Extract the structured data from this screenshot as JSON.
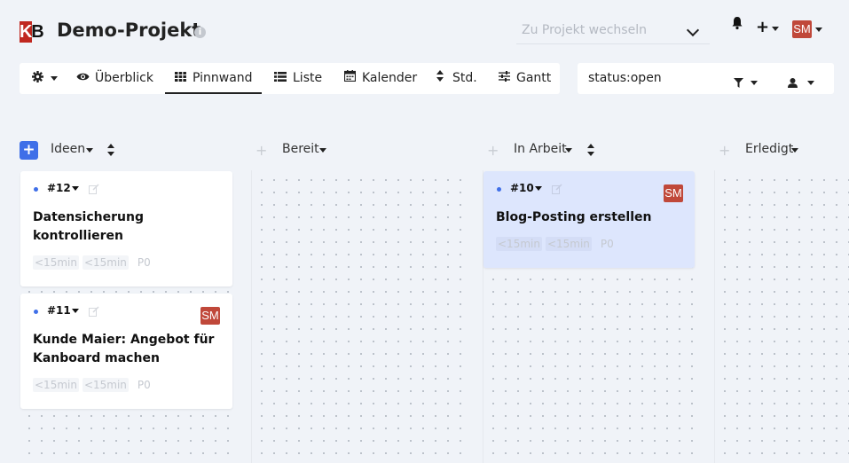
{
  "header": {
    "logo": "KB",
    "title": "Demo-Projekt",
    "project_switcher_placeholder": "Zu Projekt wechseln",
    "user_initials": "SM"
  },
  "views": [
    {
      "label": "Überblick",
      "icon": "eye-icon"
    },
    {
      "label": "Pinnwand",
      "icon": "grid-icon",
      "active": true
    },
    {
      "label": "Liste",
      "icon": "list-icon"
    },
    {
      "label": "Kalender",
      "icon": "calendar-icon"
    },
    {
      "label": "Std.",
      "icon": "sort-icon"
    },
    {
      "label": "Gantt",
      "icon": "sliders-icon"
    }
  ],
  "filter": {
    "value": "status:open"
  },
  "columns": [
    {
      "label": "Ideen"
    },
    {
      "label": "Bereit"
    },
    {
      "label": "In Arbeit"
    },
    {
      "label": "Erledigt"
    }
  ],
  "cards": [
    {
      "id": "#12",
      "title": "Datensicherung kontrollieren",
      "est1": "<15min",
      "est2": "<15min",
      "priority": "P0",
      "assignee": ""
    },
    {
      "id": "#11",
      "title": "Kunde Maier: Angebot für Kanboard machen",
      "est1": "<15min",
      "est2": "<15min",
      "priority": "P0",
      "assignee": "SM"
    },
    {
      "id": "#10",
      "title": "Blog-Posting erstellen",
      "est1": "<15min",
      "est2": "<15min",
      "priority": "P0",
      "assignee": "SM"
    }
  ],
  "colors": {
    "accent": "#3f6fe8",
    "active_card": "#dde6fd",
    "avatar": "#c0483a",
    "logo": "#c0271f"
  }
}
